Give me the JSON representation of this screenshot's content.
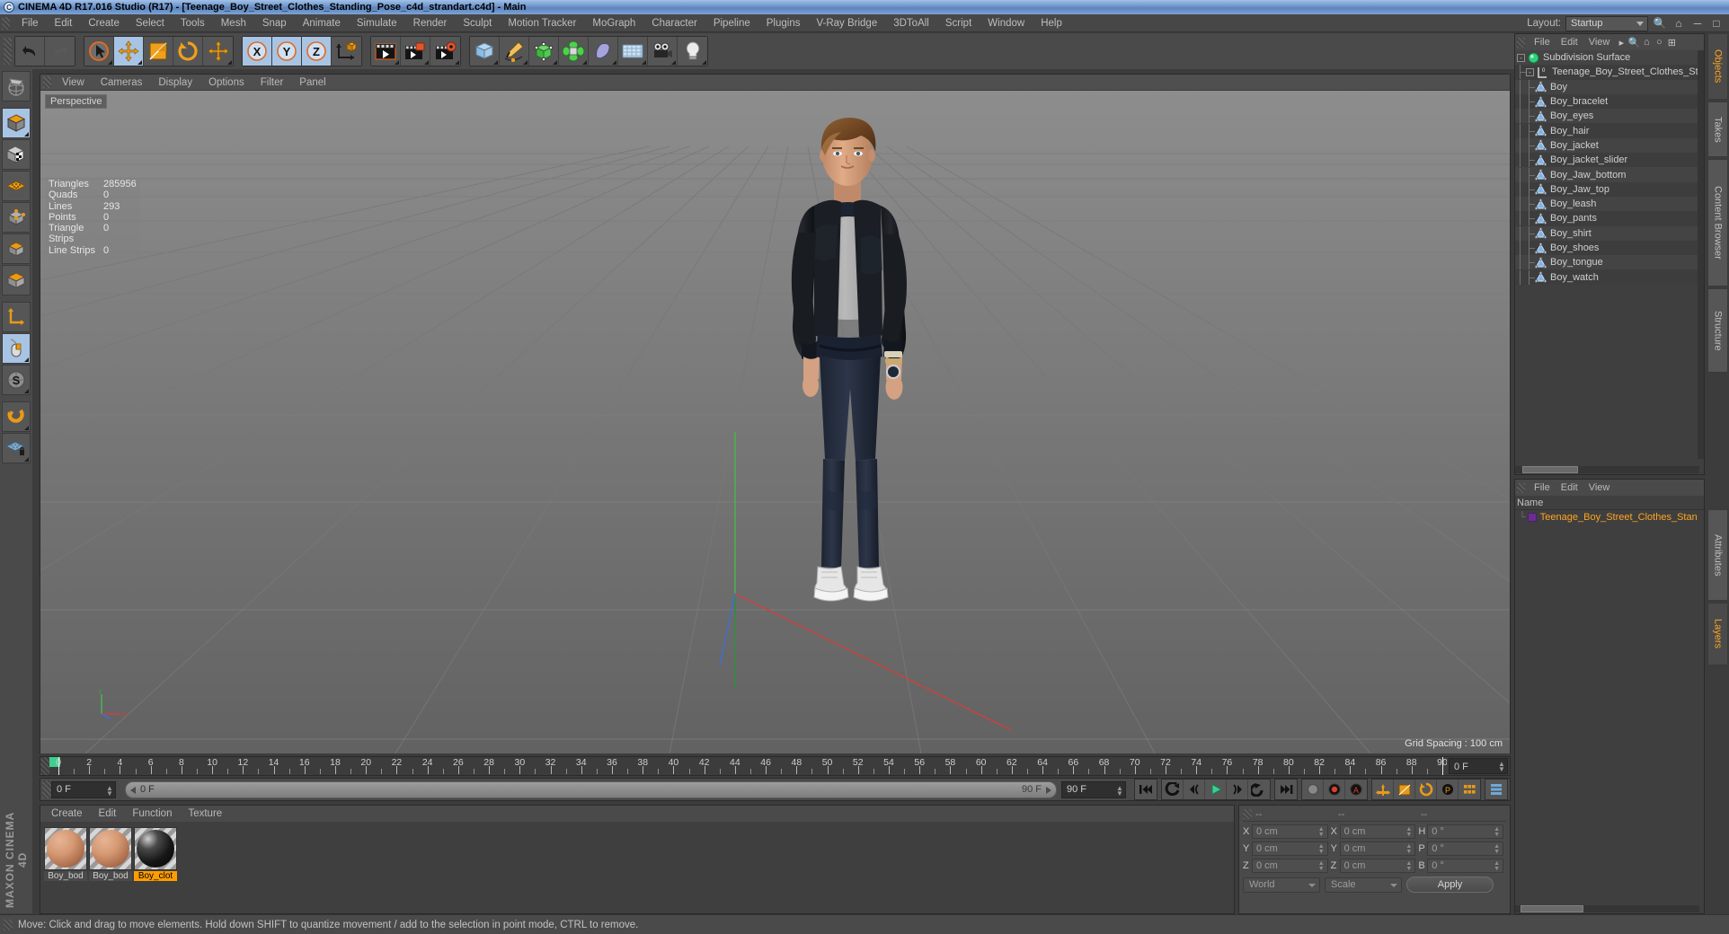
{
  "window": {
    "title": "CINEMA 4D R17.016 Studio (R17) - [Teenage_Boy_Street_Clothes_Standing_Pose_c4d_strandart.c4d] - Main",
    "app_icon": "c4d-logo-icon"
  },
  "menubar": {
    "items": [
      "File",
      "Edit",
      "Create",
      "Select",
      "Tools",
      "Mesh",
      "Snap",
      "Animate",
      "Simulate",
      "Render",
      "Sculpt",
      "Motion Tracker",
      "MoGraph",
      "Character",
      "Pipeline",
      "Plugins",
      "V-Ray Bridge",
      "3DToAll",
      "Script",
      "Window",
      "Help"
    ],
    "layout_label": "Layout:",
    "layout_value": "Startup"
  },
  "viewport": {
    "menu": [
      "View",
      "Cameras",
      "Display",
      "Options",
      "Filter",
      "Panel"
    ],
    "camera_label": "Perspective",
    "grid_spacing": "Grid Spacing : 100 cm",
    "stats": [
      {
        "key": "Triangles",
        "value": "285956"
      },
      {
        "key": "Quads",
        "value": "0"
      },
      {
        "key": "Lines",
        "value": "293"
      },
      {
        "key": "Points",
        "value": "0"
      },
      {
        "key": "Triangle Strips",
        "value": "0"
      },
      {
        "key": "Line Strips",
        "value": "0"
      }
    ]
  },
  "timeline": {
    "labels": [
      "0",
      "2",
      "4",
      "6",
      "8",
      "10",
      "12",
      "14",
      "16",
      "18",
      "20",
      "22",
      "24",
      "26",
      "28",
      "30",
      "32",
      "34",
      "36",
      "38",
      "40",
      "42",
      "44",
      "46",
      "48",
      "50",
      "52",
      "54",
      "56",
      "58",
      "60",
      "62",
      "64",
      "66",
      "68",
      "70",
      "72",
      "74",
      "76",
      "78",
      "80",
      "82",
      "84",
      "86",
      "88",
      "90"
    ],
    "current_frame_field": "0 F"
  },
  "powerslider": {
    "left_field": "0 F",
    "bar_left": "0 F",
    "bar_right": "90 F",
    "right_field": "90 F"
  },
  "material_manager": {
    "menu": [
      "Create",
      "Edit",
      "Function",
      "Texture"
    ],
    "materials": [
      {
        "name": "Boy_bod",
        "kind": "skin",
        "selected": false
      },
      {
        "name": "Boy_bod",
        "kind": "skin",
        "selected": false
      },
      {
        "name": "Boy_clot",
        "kind": "cloth",
        "selected": true
      }
    ]
  },
  "coordinates": {
    "header": [
      "--",
      "--",
      "--"
    ],
    "rows": [
      {
        "l1": "X",
        "v1": "0 cm",
        "l2": "X",
        "v2": "0 cm",
        "l3": "H",
        "v3": "0 °"
      },
      {
        "l1": "Y",
        "v1": "0 cm",
        "l2": "Y",
        "v2": "0 cm",
        "l3": "P",
        "v3": "0 °"
      },
      {
        "l1": "Z",
        "v1": "0 cm",
        "l2": "Z",
        "v2": "0 cm",
        "l3": "B",
        "v3": "0 °"
      }
    ],
    "system": "World",
    "mode": "Scale",
    "apply": "Apply"
  },
  "object_manager": {
    "menu": [
      "File",
      "Edit",
      "View"
    ],
    "items": [
      {
        "label": "Subdivision Surface",
        "depth": 0,
        "icon": "subdivision-surface-icon"
      },
      {
        "label": "Teenage_Boy_Street_Clothes_Stan",
        "depth": 1,
        "icon": "null-object-icon"
      },
      {
        "label": "Boy",
        "depth": 2,
        "icon": "polygon-object-icon"
      },
      {
        "label": "Boy_bracelet",
        "depth": 2,
        "icon": "polygon-object-icon"
      },
      {
        "label": "Boy_eyes",
        "depth": 2,
        "icon": "polygon-object-icon"
      },
      {
        "label": "Boy_hair",
        "depth": 2,
        "icon": "polygon-object-icon"
      },
      {
        "label": "Boy_jacket",
        "depth": 2,
        "icon": "polygon-object-icon"
      },
      {
        "label": "Boy_jacket_slider",
        "depth": 2,
        "icon": "polygon-object-icon"
      },
      {
        "label": "Boy_Jaw_bottom",
        "depth": 2,
        "icon": "polygon-object-icon"
      },
      {
        "label": "Boy_Jaw_top",
        "depth": 2,
        "icon": "polygon-object-icon"
      },
      {
        "label": "Boy_leash",
        "depth": 2,
        "icon": "polygon-object-icon"
      },
      {
        "label": "Boy_pants",
        "depth": 2,
        "icon": "polygon-object-icon"
      },
      {
        "label": "Boy_shirt",
        "depth": 2,
        "icon": "polygon-object-icon"
      },
      {
        "label": "Boy_shoes",
        "depth": 2,
        "icon": "polygon-object-icon"
      },
      {
        "label": "Boy_tongue",
        "depth": 2,
        "icon": "polygon-object-icon"
      },
      {
        "label": "Boy_watch",
        "depth": 2,
        "icon": "polygon-object-icon"
      }
    ]
  },
  "layer_manager": {
    "menu": [
      "File",
      "Edit",
      "View"
    ],
    "column": "Name",
    "layer_name": "Teenage_Boy_Street_Clothes_Stan",
    "layer_color": "#6b2e8e"
  },
  "right_tabs_top": [
    "Objects",
    "Takes",
    "Content Browser",
    "Structure"
  ],
  "right_tabs_bottom": [
    "Attributes",
    "Layers"
  ],
  "status": {
    "message": "Move: Click and drag to move elements. Hold down SHIFT to quantize movement / add to the selection in point mode, CTRL to remove."
  },
  "branding": "MAXON CINEMA 4D",
  "colors": {
    "accent_orange": "#ff9d00",
    "selection_blue": "#a8c4e4",
    "play_green": "#3ecf8e",
    "layer_purple": "#6b2e8e"
  }
}
